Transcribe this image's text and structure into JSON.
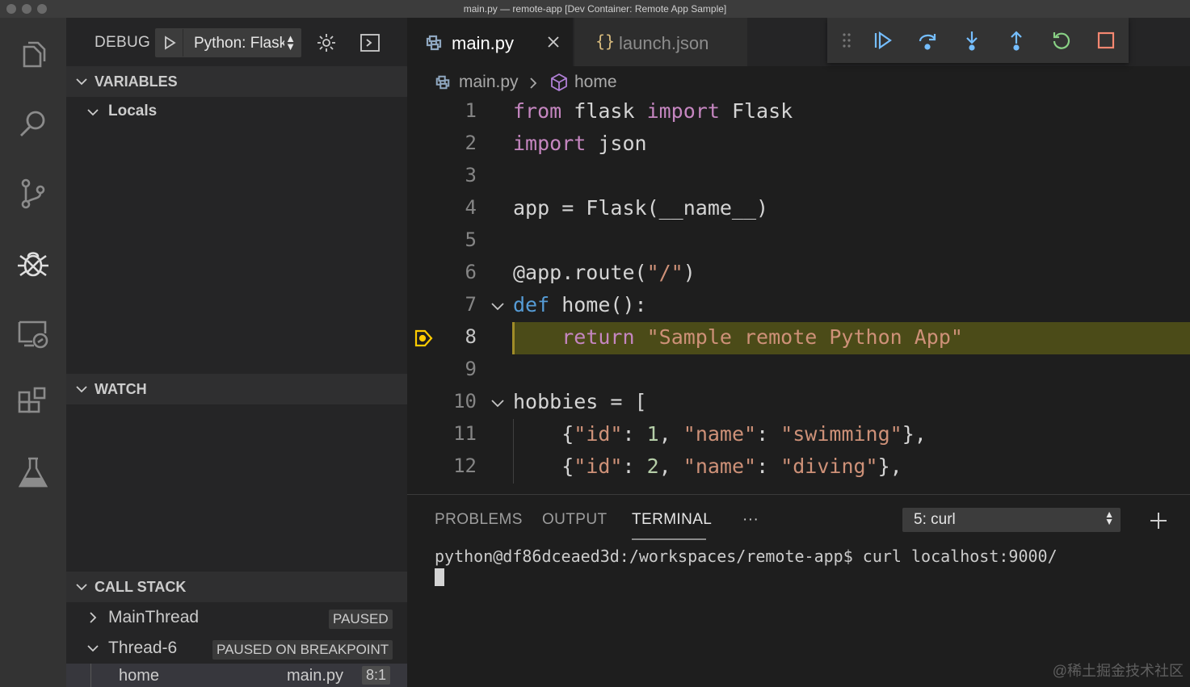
{
  "window": {
    "title": "main.py — remote-app [Dev Container: Remote App Sample]"
  },
  "activity_bar": {
    "icons": [
      "files-icon",
      "search-icon",
      "source-control-icon",
      "debug-icon",
      "remote-explorer-icon",
      "extensions-icon",
      "test-flask-icon"
    ]
  },
  "sidebar": {
    "debug_label": "DEBUG",
    "config_name": "Python: Flask",
    "sections": {
      "variables": "VARIABLES",
      "locals": "Locals",
      "watch": "WATCH",
      "call_stack": "CALL STACK"
    },
    "threads": [
      {
        "name": "MainThread",
        "state": "PAUSED"
      },
      {
        "name": "Thread-6",
        "state": "PAUSED ON BREAKPOINT"
      }
    ],
    "frame": {
      "name": "home",
      "file": "main.py",
      "position": "8:1"
    }
  },
  "editor": {
    "tabs": [
      {
        "label": "main.py",
        "active": true
      },
      {
        "label": "launch.json",
        "active": false
      }
    ],
    "breadcrumb": {
      "file": "main.py",
      "symbol": "home"
    },
    "current_line": 8,
    "lines": [
      {
        "n": "1",
        "code": "from flask import Flask"
      },
      {
        "n": "2",
        "code": "import json"
      },
      {
        "n": "3",
        "code": ""
      },
      {
        "n": "4",
        "code": "app = Flask(__name__)"
      },
      {
        "n": "5",
        "code": ""
      },
      {
        "n": "6",
        "code": "@app.route(\"/\")"
      },
      {
        "n": "7",
        "code": "def home():"
      },
      {
        "n": "8",
        "code": "    return \"Sample remote Python App\""
      },
      {
        "n": "9",
        "code": ""
      },
      {
        "n": "10",
        "code": "hobbies = ["
      },
      {
        "n": "11",
        "code": "    {\"id\": 1, \"name\": \"swimming\"},"
      },
      {
        "n": "12",
        "code": "    {\"id\": 2, \"name\": \"diving\"},"
      }
    ]
  },
  "panel": {
    "tabs": [
      "PROBLEMS",
      "OUTPUT",
      "TERMINAL"
    ],
    "active_tab": "TERMINAL",
    "more": "···",
    "terminal_select": "5: curl",
    "prompt": "python@df86dceaed3d:/workspaces/remote-app$",
    "command": " curl localhost:9000/"
  },
  "watermark": "@稀土掘金技术社区",
  "colors": {
    "activity_bar": "#333333",
    "sidebar": "#252526",
    "editor": "#1e1e1e",
    "current_line": "#4b4b18",
    "keyword": "#c586c0",
    "string": "#ce9178"
  }
}
